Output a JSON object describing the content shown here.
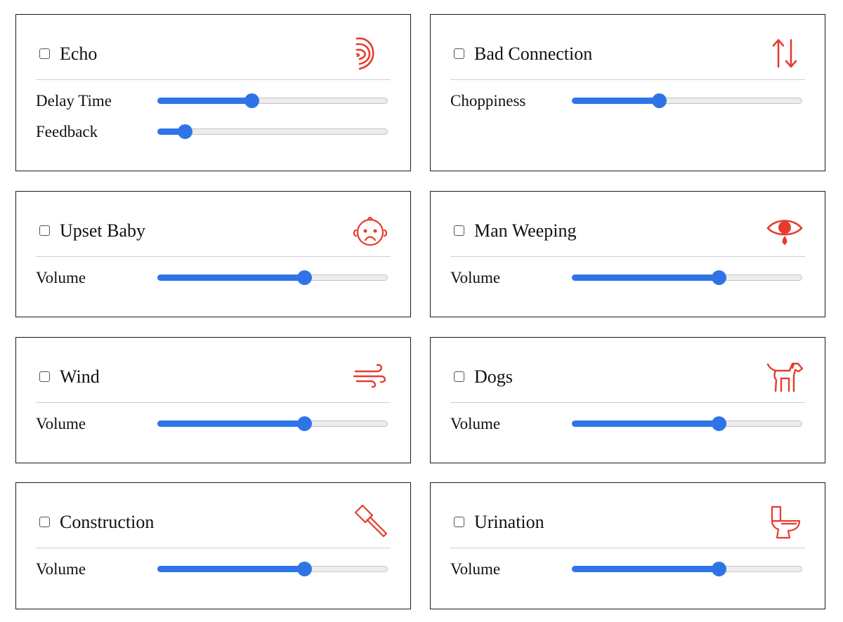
{
  "accent_color": "#2f74e7",
  "icon_color": "#e53c2e",
  "effects": [
    {
      "title": "Echo",
      "icon": "echo-waves-icon",
      "enabled": false,
      "params": [
        {
          "label": "Delay Time",
          "value": 0.41
        },
        {
          "label": "Feedback",
          "value": 0.12
        }
      ]
    },
    {
      "title": "Bad Connection",
      "icon": "up-down-arrows-icon",
      "enabled": false,
      "params": [
        {
          "label": "Choppiness",
          "value": 0.38
        }
      ]
    },
    {
      "title": "Upset Baby",
      "icon": "sad-baby-face-icon",
      "enabled": false,
      "params": [
        {
          "label": "Volume",
          "value": 0.64
        }
      ]
    },
    {
      "title": "Man Weeping",
      "icon": "weeping-eye-icon",
      "enabled": false,
      "params": [
        {
          "label": "Volume",
          "value": 0.64
        }
      ]
    },
    {
      "title": "Wind",
      "icon": "wind-icon",
      "enabled": false,
      "params": [
        {
          "label": "Volume",
          "value": 0.64
        }
      ]
    },
    {
      "title": "Dogs",
      "icon": "dog-icon",
      "enabled": false,
      "params": [
        {
          "label": "Volume",
          "value": 0.64
        }
      ]
    },
    {
      "title": "Construction",
      "icon": "hammer-icon",
      "enabled": false,
      "params": [
        {
          "label": "Volume",
          "value": 0.64
        }
      ]
    },
    {
      "title": "Urination",
      "icon": "toilet-icon",
      "enabled": false,
      "params": [
        {
          "label": "Volume",
          "value": 0.64
        }
      ]
    }
  ]
}
